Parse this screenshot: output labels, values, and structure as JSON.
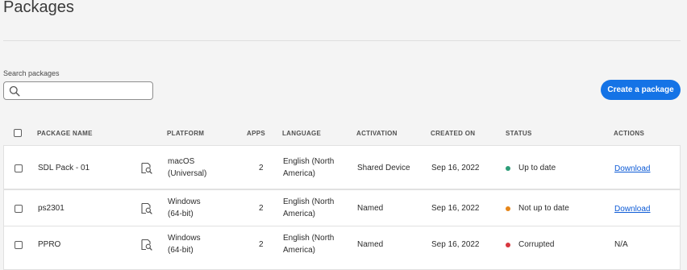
{
  "page": {
    "title": "Packages"
  },
  "search": {
    "label": "Search packages",
    "placeholder": "",
    "value": ""
  },
  "create_button": {
    "label": "Create a package"
  },
  "colors": {
    "accent": "#1473e6",
    "link": "#0d5bd6",
    "status_ok": "#2d9d78",
    "status_warn": "#e68619",
    "status_error": "#d7373f"
  },
  "table": {
    "columns": {
      "name": "PACKAGE NAME",
      "platform": "PLATFORM",
      "apps": "APPS",
      "language": "LANGUAGE",
      "activation": "ACTIVATION",
      "created": "CREATED ON",
      "status": "STATUS",
      "actions": "ACTIONS"
    },
    "rows": [
      {
        "name": "SDL Pack - 01",
        "platform_line1": "macOS",
        "platform_line2": "(Universal)",
        "apps": "2",
        "language_line1": "English (North",
        "language_line2": "America)",
        "activation": "Shared Device",
        "created": "Sep 16, 2022",
        "status": "Up to date",
        "status_color": "#2d9d78",
        "action": "Download"
      },
      {
        "name": "ps2301",
        "platform_line1": "Windows",
        "platform_line2": "(64-bit)",
        "apps": "2",
        "language_line1": "English (North",
        "language_line2": "America)",
        "activation": "Named",
        "created": "Sep 16, 2022",
        "status": "Not up to date",
        "status_color": "#e68619",
        "action": "Download"
      },
      {
        "name": "PPRO",
        "platform_line1": "Windows",
        "platform_line2": "(64-bit)",
        "apps": "2",
        "language_line1": "English (North",
        "language_line2": "America)",
        "activation": "Named",
        "created": "Sep 16, 2022",
        "status": "Corrupted",
        "status_color": "#d7373f",
        "action": "N/A"
      }
    ]
  }
}
